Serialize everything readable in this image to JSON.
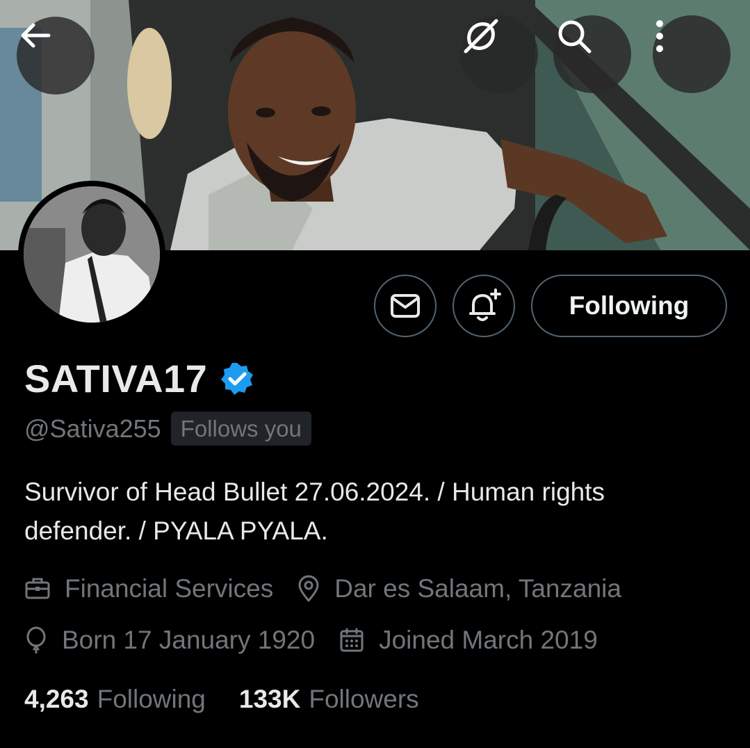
{
  "header": {
    "back_icon": "arrow-left-icon",
    "grok_icon": "grok-icon",
    "search_icon": "search-icon",
    "more_icon": "more-vertical-icon"
  },
  "actions": {
    "message_icon": "mail-icon",
    "notify_icon": "bell-plus-icon",
    "follow_label": "Following"
  },
  "profile": {
    "display_name": "SATIVA17",
    "verified_color": "#1d9bf0",
    "handle": "@Sativa255",
    "follows_you": "Follows you",
    "bio_line1": "Survivor of Head Bullet 27.06.2024. / Human rights",
    "bio_line2": "defender. / PYALA PYALA.",
    "category": "Financial Services",
    "location": "Dar es Salaam, Tanzania",
    "born": "Born 17 January 1920",
    "joined": "Joined March 2019",
    "following_count": "4,263",
    "following_label": "Following",
    "followers_count": "133K",
    "followers_label": "Followers"
  },
  "colors": {
    "background": "#000000",
    "primary_text": "#e7e9ea",
    "secondary_text": "#71767b",
    "border": "#536471"
  }
}
